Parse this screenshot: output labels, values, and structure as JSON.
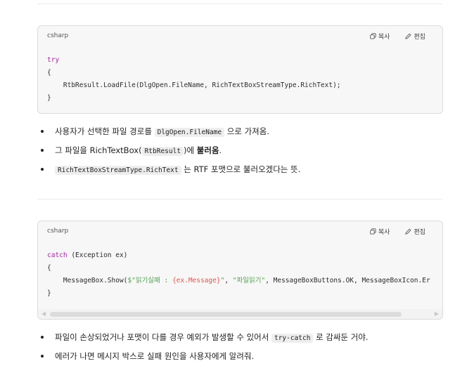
{
  "block1": {
    "lang": "csharp",
    "copy_label": "복사",
    "edit_label": "편집",
    "lines": [
      "try",
      "{",
      "    RtbResult.LoadFile(DlgOpen.FileName, RichTextBoxStreamType.RichText);",
      "}"
    ]
  },
  "bullets1": [
    {
      "pre": "사용자가 선택한 파일 경로를 ",
      "code": "DlgOpen.FileName",
      "post": " 으로 가져옴."
    },
    {
      "pre": "그 파일을 RichTextBox(",
      "code": "RtbResult",
      "post": ")에 ",
      "strong": "불러옴",
      "tail": "."
    },
    {
      "pre": "",
      "code": "RichTextBoxStreamType.RichText",
      "post": " 는 RTF 포맷으로 불러오겠다는 뜻."
    }
  ],
  "block2": {
    "lang": "csharp",
    "copy_label": "복사",
    "edit_label": "편집",
    "line1_kw": "catch",
    "line1_rest": " (Exception ex)",
    "line2": "{",
    "line3_a": "    MessageBox.Show(",
    "line3_str1": "$\"읽기실패 : ",
    "line3_interp": "{ex.Message}",
    "line3_str1_end": "\"",
    "line3_b": ", ",
    "line3_str2": "\"파일읽기\"",
    "line3_c": ", MessageBoxButtons.OK, MessageBoxIcon.Er",
    "line4": "}"
  },
  "bullets2": [
    {
      "pre": "파일이 손상되었거나 포맷이 다를 경우 예외가 발생할 수 있어서 ",
      "code": "try-catch",
      "post": " 로 감싸둔 거야."
    },
    {
      "pre": "에러가 나면 메시지 박스로 실패 원인을 사용자에게 알려줘.",
      "code": "",
      "post": ""
    }
  ]
}
